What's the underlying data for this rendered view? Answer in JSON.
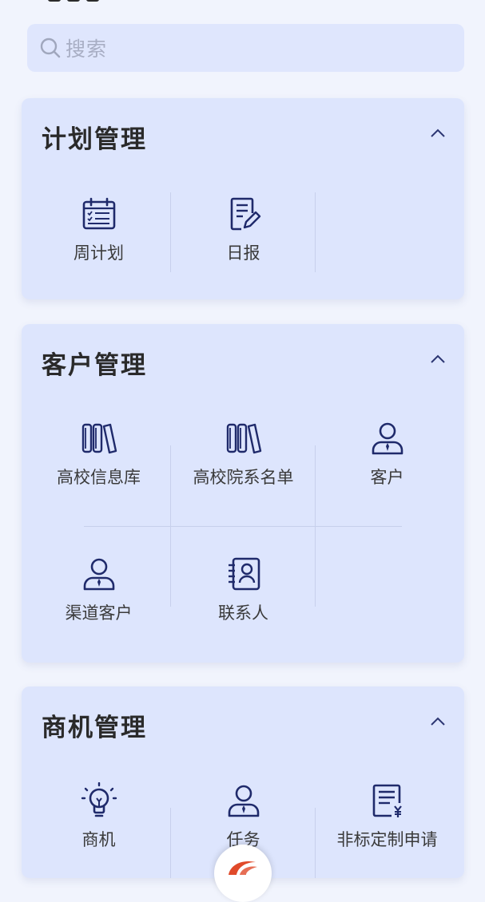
{
  "search": {
    "placeholder": "搜索",
    "icon": "search-icon"
  },
  "sections": {
    "plan": {
      "title": "计划管理",
      "items": [
        {
          "label": "周计划",
          "icon": "calendar-checklist-icon"
        },
        {
          "label": "日报",
          "icon": "document-edit-icon"
        }
      ]
    },
    "customer": {
      "title": "客户管理",
      "items": [
        {
          "label": "高校信息库",
          "icon": "books-icon"
        },
        {
          "label": "高校院系名单",
          "icon": "books-icon"
        },
        {
          "label": "客户",
          "icon": "person-tie-icon"
        },
        {
          "label": "渠道客户",
          "icon": "person-tie-icon"
        },
        {
          "label": "联系人",
          "icon": "contact-card-icon"
        }
      ]
    },
    "opportunity": {
      "title": "商机管理",
      "items": [
        {
          "label": "商机",
          "icon": "lightbulb-icon"
        },
        {
          "label": "任务",
          "icon": "person-tie-icon"
        },
        {
          "label": "非标定制申请",
          "icon": "invoice-yen-icon"
        }
      ]
    }
  },
  "colors": {
    "accent": "#1f2a6b",
    "card": "#dde5fd",
    "background": "#f1f4fd",
    "logo": "#e04a2a"
  }
}
